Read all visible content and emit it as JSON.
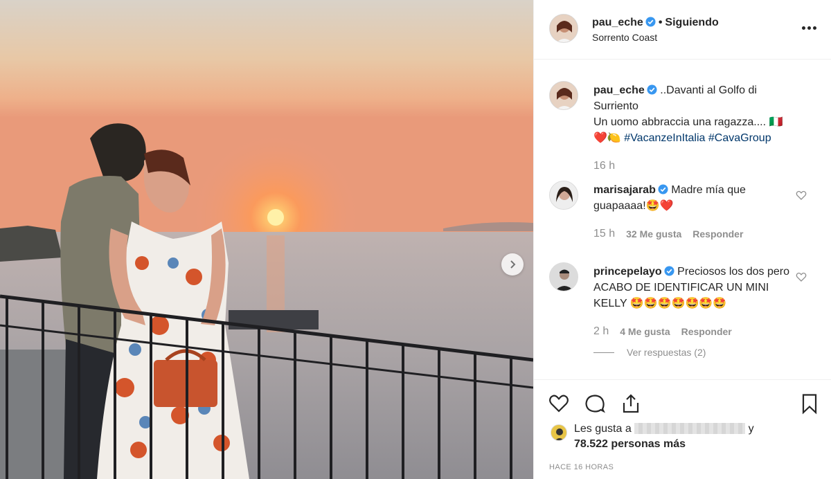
{
  "header": {
    "username": "pau_eche",
    "dot": "•",
    "follow_status": "Siguiendo",
    "location": "Sorrento Coast"
  },
  "caption": {
    "username": "pau_eche",
    "line1": "..Davanti al Golfo di Surriento",
    "line2": "Un uomo abbraccia una ragazza.... 🇮🇹",
    "emojis": "❤️🍋",
    "hashtags": [
      "#VacanzeInItalia",
      "#CavaGroup"
    ],
    "time": "16 h"
  },
  "comments": [
    {
      "username": "marisajarab",
      "text": "Madre mía que guapaaaa!🤩❤️",
      "time": "15 h",
      "likes": "32 Me gusta",
      "reply": "Responder"
    },
    {
      "username": "princepelayo",
      "text": "Preciosos los dos pero ACABO DE IDENTIFICAR UN MINI KELLY 🤩🤩🤩🤩🤩🤩🤩",
      "time": "2 h",
      "likes": "4 Me gusta",
      "reply": "Responder",
      "view_replies": "Ver respuestas (2)"
    }
  ],
  "likes": {
    "prefix": "Les gusta a",
    "suffix": "y",
    "count_text": "78.522 personas más"
  },
  "posted_ago": "HACE 16 HORAS",
  "icons": {
    "verified": "verified-badge-icon",
    "more": "more-options-icon",
    "like": "heart-icon",
    "comment": "comment-icon",
    "share": "share-icon",
    "save": "bookmark-icon",
    "next": "chevron-right-icon"
  },
  "colors": {
    "verified_blue": "#3897f0",
    "heart_red": "#ed4956",
    "hashtag": "#00376b",
    "muted": "#8e8e8e"
  }
}
